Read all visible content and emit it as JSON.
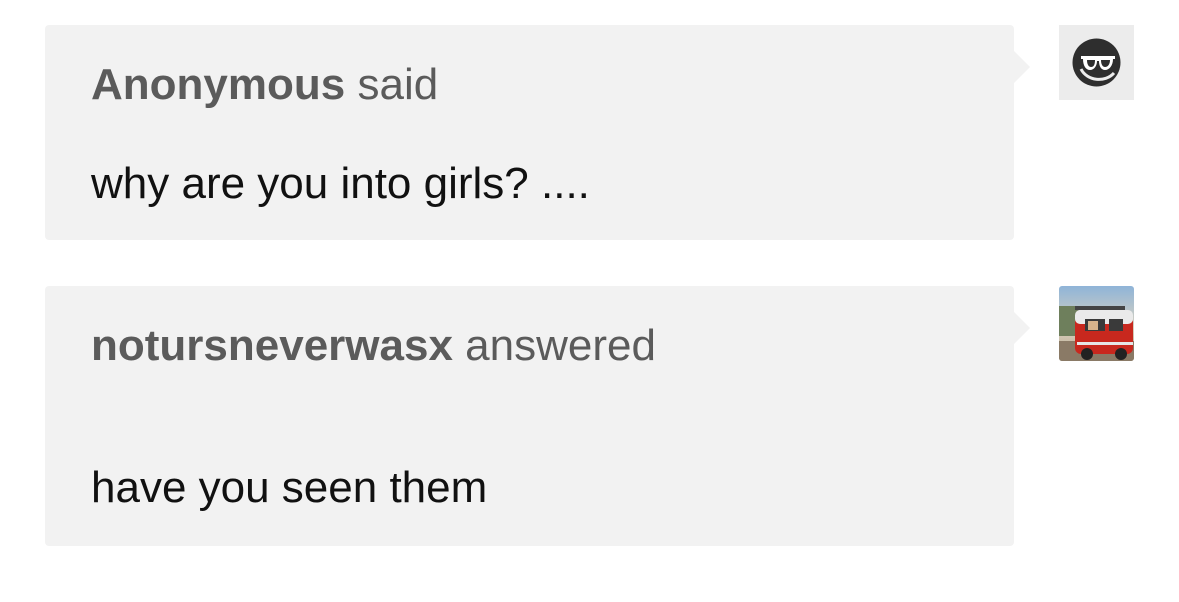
{
  "ask": {
    "author": "Anonymous",
    "verb": "said",
    "text": "why are you into girls? ....",
    "avatar_icon": "anonymous-sunglasses-icon"
  },
  "answer": {
    "author": "notursneverwasx",
    "verb": "answered",
    "text": "have you seen them",
    "avatar_icon": "red-van-photo"
  },
  "colors": {
    "bubble_bg": "#f2f2f2",
    "header_text": "#5b5b5b",
    "body_text": "#111111"
  }
}
